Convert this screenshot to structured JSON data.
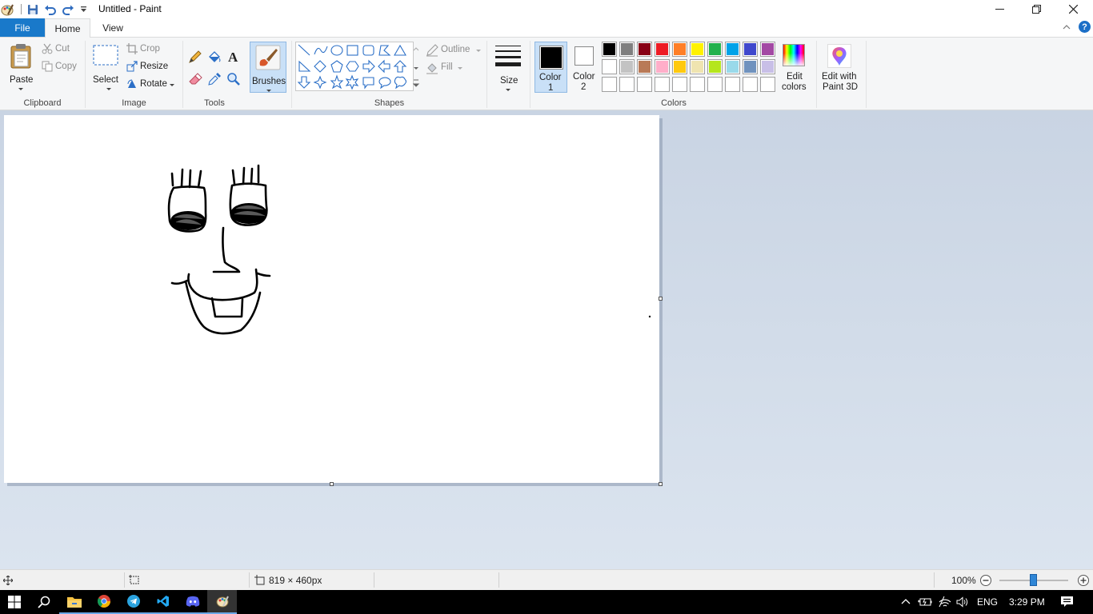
{
  "window": {
    "title": "Untitled - Paint"
  },
  "tabs": {
    "file": "File",
    "home": "Home",
    "view": "View"
  },
  "ribbon": {
    "clipboard": {
      "group_label": "Clipboard",
      "paste": "Paste",
      "cut": "Cut",
      "copy": "Copy"
    },
    "image": {
      "group_label": "Image",
      "select": "Select",
      "crop": "Crop",
      "resize": "Resize",
      "rotate": "Rotate"
    },
    "tools": {
      "group_label": "Tools"
    },
    "brushes": {
      "label": "Brushes"
    },
    "shapes": {
      "group_label": "Shapes",
      "outline": "Outline",
      "fill": "Fill"
    },
    "size": {
      "label": "Size"
    },
    "colors": {
      "group_label": "Colors",
      "color1_line1": "Color",
      "color1_line2": "1",
      "color2_line1": "Color",
      "color2_line2": "2",
      "color1_value": "#000000",
      "color2_value": "#ffffff",
      "edit_colors_line1": "Edit",
      "edit_colors_line2": "colors",
      "palette_row1": [
        "#000000",
        "#7f7f7f",
        "#880015",
        "#ed1c24",
        "#ff7f27",
        "#fff200",
        "#22b14c",
        "#00a2e8",
        "#3f48cc",
        "#a349a4"
      ],
      "palette_row2": [
        "#ffffff",
        "#c3c3c3",
        "#b97a57",
        "#ffaec9",
        "#ffc90e",
        "#efe4b0",
        "#b5e61d",
        "#99d9ea",
        "#7092be",
        "#c8bfe7"
      ]
    },
    "paint3d": {
      "line1": "Edit with",
      "line2": "Paint 3D"
    }
  },
  "statusbar": {
    "image_size": "819 × 460px",
    "zoom": "100%",
    "zoom_fraction": 0.5
  },
  "taskbar": {
    "language": "ENG",
    "time": "3:29 PM"
  }
}
